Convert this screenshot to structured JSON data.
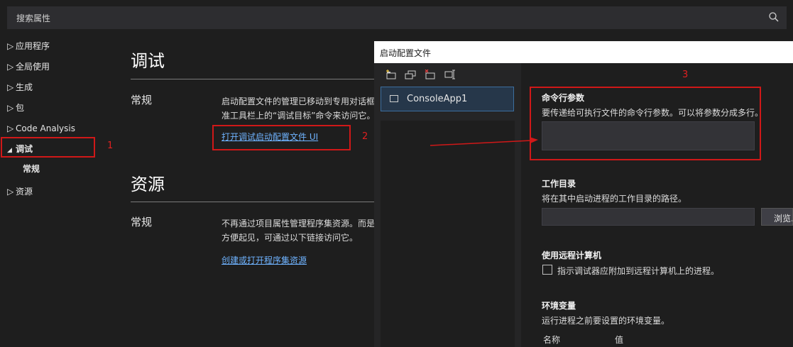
{
  "search": {
    "placeholder": "搜索属性",
    "icon": "search-icon"
  },
  "sidebar": {
    "items": [
      {
        "label": "应用程序",
        "expanded": false
      },
      {
        "label": "全局使用",
        "expanded": false
      },
      {
        "label": "生成",
        "expanded": false
      },
      {
        "label": "包",
        "expanded": false
      },
      {
        "label": "Code Analysis",
        "expanded": false
      },
      {
        "label": "调试",
        "expanded": true,
        "selected": true
      },
      {
        "label": "资源",
        "expanded": false
      }
    ],
    "debug_child": "常规"
  },
  "annotations": {
    "n1": "1",
    "n2": "2",
    "n3": "3",
    "color": "#d01818"
  },
  "main": {
    "debug_title": "调试",
    "debug_general": "常规",
    "debug_desc_line1": "启动配置文件的管理已移动到专用对话框",
    "debug_desc_line2": "准工具栏上的“调试目标”命令来访问它。",
    "debug_link": "打开调试启动配置文件 UI",
    "resources_title": "资源",
    "resources_general": "常规",
    "resources_desc_line1": "不再通过项目属性管理程序集资源。而是",
    "resources_desc_line2": "方便起见，可通过以下链接访问它。",
    "resources_link": "创建或打开程序集资源"
  },
  "dialog": {
    "title": "启动配置文件",
    "toolbar_icons": [
      "new-profile-icon",
      "duplicate-profile-icon",
      "delete-profile-icon",
      "rename-profile-icon"
    ],
    "profiles": [
      "ConsoleApp1"
    ],
    "cmd_args": {
      "label": "命令行参数",
      "desc": "要传递给可执行文件的命令行参数。可以将参数分成多行。",
      "value": ""
    },
    "working_dir": {
      "label": "工作目录",
      "desc": "将在其中启动进程的工作目录的路径。",
      "value": "",
      "browse": "浏览..."
    },
    "remote": {
      "label": "使用远程计算机",
      "checkbox_label": "指示调试器应附加到远程计算机上的进程。",
      "checked": false
    },
    "env": {
      "label": "环境变量",
      "desc": "运行进程之前要设置的环境变量。",
      "col_name": "名称",
      "col_value": "值"
    }
  }
}
